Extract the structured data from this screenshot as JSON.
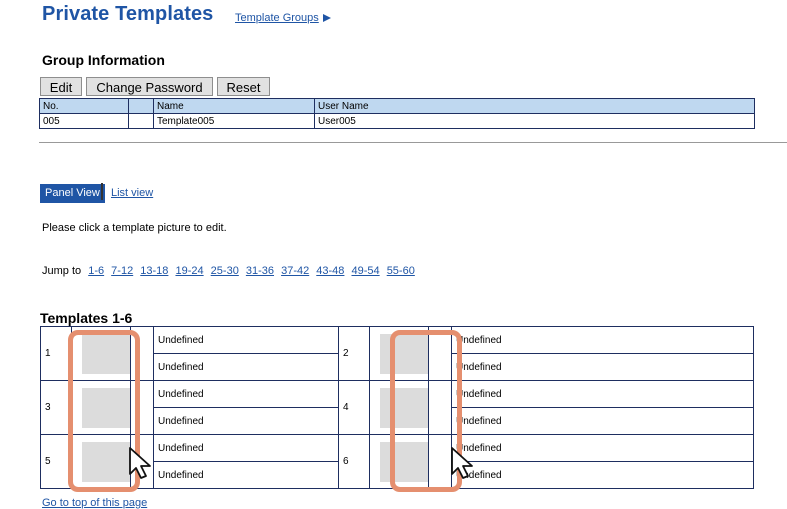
{
  "header": {
    "title": "Private Templates",
    "groups_link": "Template Groups"
  },
  "group_info": {
    "heading": "Group Information",
    "buttons": {
      "edit": "Edit",
      "change_password": "Change Password",
      "reset": "Reset"
    },
    "columns": [
      "No.",
      "",
      "Name",
      "User Name"
    ],
    "row": [
      "005",
      "",
      "Template005",
      "User005"
    ]
  },
  "views": {
    "panel": "Panel View",
    "list": "List view"
  },
  "instruction": "Please click a template picture to edit.",
  "jump": {
    "label": "Jump to",
    "ranges": [
      "1-6",
      "7-12",
      "13-18",
      "19-24",
      "25-30",
      "31-36",
      "37-42",
      "43-48",
      "49-54",
      "55-60"
    ]
  },
  "templates": {
    "heading": "Templates 1-6",
    "items": [
      {
        "no": "1",
        "label1": "Undefined",
        "label2": "Undefined"
      },
      {
        "no": "2",
        "label1": "Undefined",
        "label2": "Undefined"
      },
      {
        "no": "3",
        "label1": "Undefined",
        "label2": "Undefined"
      },
      {
        "no": "4",
        "label1": "Undefined",
        "label2": "Undefined"
      },
      {
        "no": "5",
        "label1": "Undefined",
        "label2": "Undefined"
      },
      {
        "no": "6",
        "label1": "Undefined",
        "label2": "Undefined"
      }
    ]
  },
  "footer": {
    "top_link": "Go to top of this page"
  },
  "colors": {
    "link": "#1f55a5",
    "table_header": "#bfd8f0",
    "highlight": "#e58f6f",
    "thumbnail": "#dcdcdc"
  }
}
